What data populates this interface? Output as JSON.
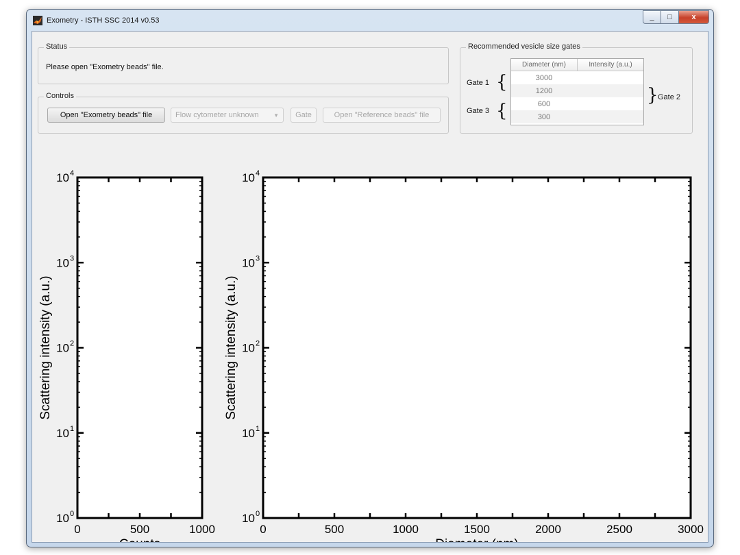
{
  "window": {
    "title": "Exometry - ISTH SSC 2014 v0.53",
    "close_glyph": "x",
    "minimize_glyph": "_",
    "maximize_glyph": "□"
  },
  "status": {
    "legend": "Status",
    "text": "Please open \"Exometry beads\" file."
  },
  "controls": {
    "legend": "Controls",
    "open_exometry_label": "Open \"Exometry beads\" file",
    "cytometer_select": "Flow cytometer unknown",
    "gate_label": "Gate",
    "open_reference_label": "Open \"Reference beads\" file"
  },
  "gates": {
    "legend": "Recommended vesicle size gates",
    "headers": [
      "Diameter (nm)",
      "Intensity (a.u.)"
    ],
    "rows": [
      {
        "diameter": "3000",
        "intensity": ""
      },
      {
        "diameter": "1200",
        "intensity": ""
      },
      {
        "diameter": "600",
        "intensity": ""
      },
      {
        "diameter": "300",
        "intensity": ""
      }
    ],
    "gate1": "Gate 1",
    "gate2": "Gate 2",
    "gate3": "Gate 3"
  },
  "chart_data": [
    {
      "type": "scatter",
      "xlabel": "Counts",
      "ylabel": "Scattering intensity (a.u.)",
      "xlim": [
        0,
        1000
      ],
      "ylim": [
        1,
        10000
      ],
      "yscale": "log",
      "xticks": [
        "0",
        "500",
        "1000"
      ],
      "yticks": [
        "10^0",
        "10^1",
        "10^2",
        "10^3",
        "10^4"
      ],
      "series": []
    },
    {
      "type": "scatter",
      "xlabel": "Diameter (nm)",
      "ylabel": "Scattering intensity (a.u.)",
      "xlim": [
        0,
        3000
      ],
      "ylim": [
        1,
        10000
      ],
      "yscale": "log",
      "xticks": [
        "0",
        "500",
        "1000",
        "1500",
        "2000",
        "2500",
        "3000"
      ],
      "yticks": [
        "10^0",
        "10^1",
        "10^2",
        "10^3",
        "10^4"
      ],
      "series": []
    }
  ]
}
